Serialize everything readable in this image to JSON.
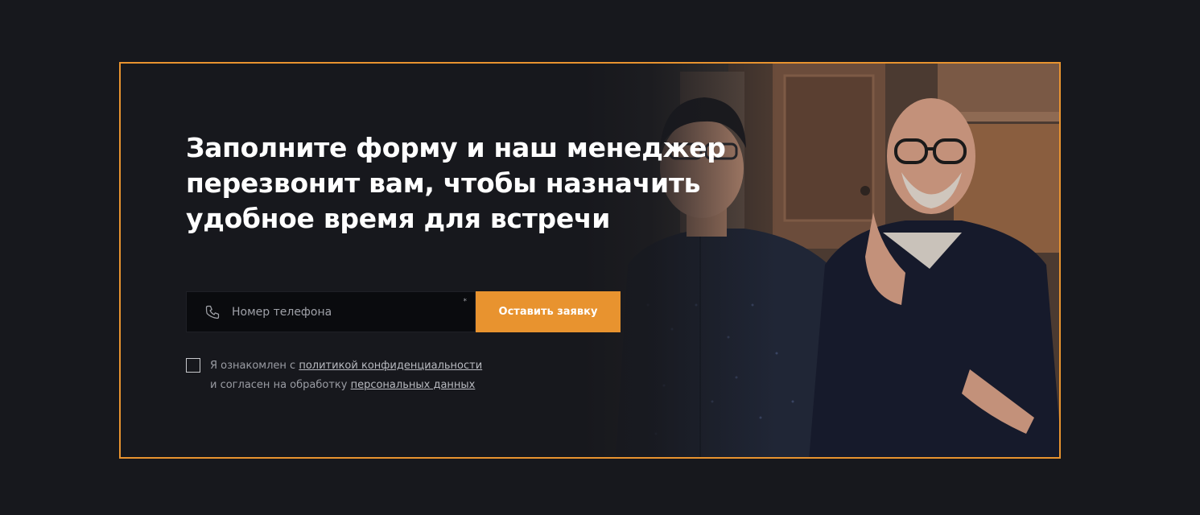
{
  "cta": {
    "headline_lines": [
      "Заполните форму и наш менеджер",
      "перезвонит вам, чтобы назначить",
      "удобное время для встречи"
    ],
    "phone_placeholder": "Номер телефона",
    "required_mark": "*",
    "submit_label": "Оставить заявку",
    "consent": {
      "text_1": "Я ознакомлен с ",
      "link_privacy": "политикой конфиденциальности",
      "text_2": "и согласен на обработку ",
      "link_personal": "персональных данных",
      "checked": false
    },
    "icons": {
      "phone": "phone-icon"
    },
    "colors": {
      "accent": "#e8932f",
      "background": "#17181d",
      "input_background": "#0a0b0e"
    }
  }
}
